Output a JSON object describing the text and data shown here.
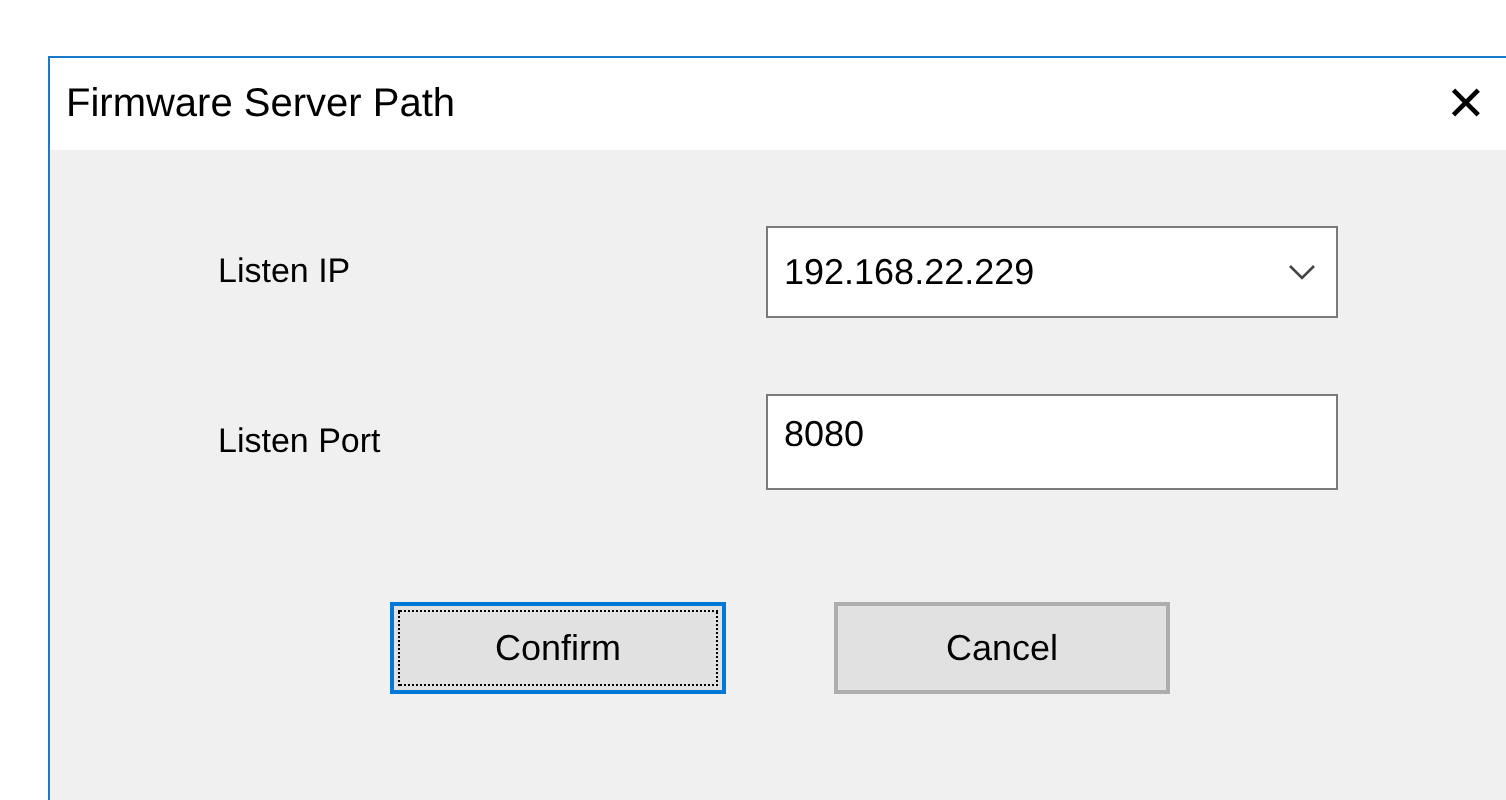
{
  "window": {
    "title": "Firmware Server Path",
    "close": "✕"
  },
  "fields": [
    {
      "kind": "dropdown",
      "label": "Listen IP",
      "value": "192.168.22.229"
    },
    {
      "kind": "text",
      "label": "Listen Port",
      "value": "8080"
    }
  ],
  "buttons": [
    {
      "label": "Confirm",
      "focused": true
    },
    {
      "label": "Cancel",
      "focused": false
    }
  ]
}
